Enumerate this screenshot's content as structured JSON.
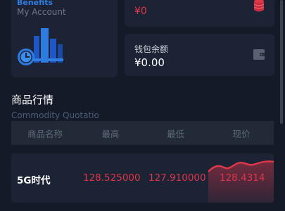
{
  "account": {
    "title": "Benefits",
    "subtitle": "My Account"
  },
  "balance": {
    "label": "",
    "value": "¥0"
  },
  "wallet": {
    "label": "钱包余额",
    "value": "¥0.00"
  },
  "market": {
    "title": "商品行情",
    "subtitle": "Commodity Quotation",
    "columns": [
      "商品名称",
      "最高",
      "最低",
      "现价"
    ],
    "rows": [
      {
        "name": "5G时代",
        "high": "128.525000",
        "low": "127.910000",
        "current": "128.4314"
      }
    ]
  },
  "colors": {
    "background": "#141a28",
    "card": "#1c2334",
    "accent_red": "#e0364a",
    "accent_blue": "#2f7de1"
  },
  "icons": {
    "coin": "coin-stack-icon",
    "wallet": "wallet-icon",
    "account": "chart-clock-icon"
  }
}
